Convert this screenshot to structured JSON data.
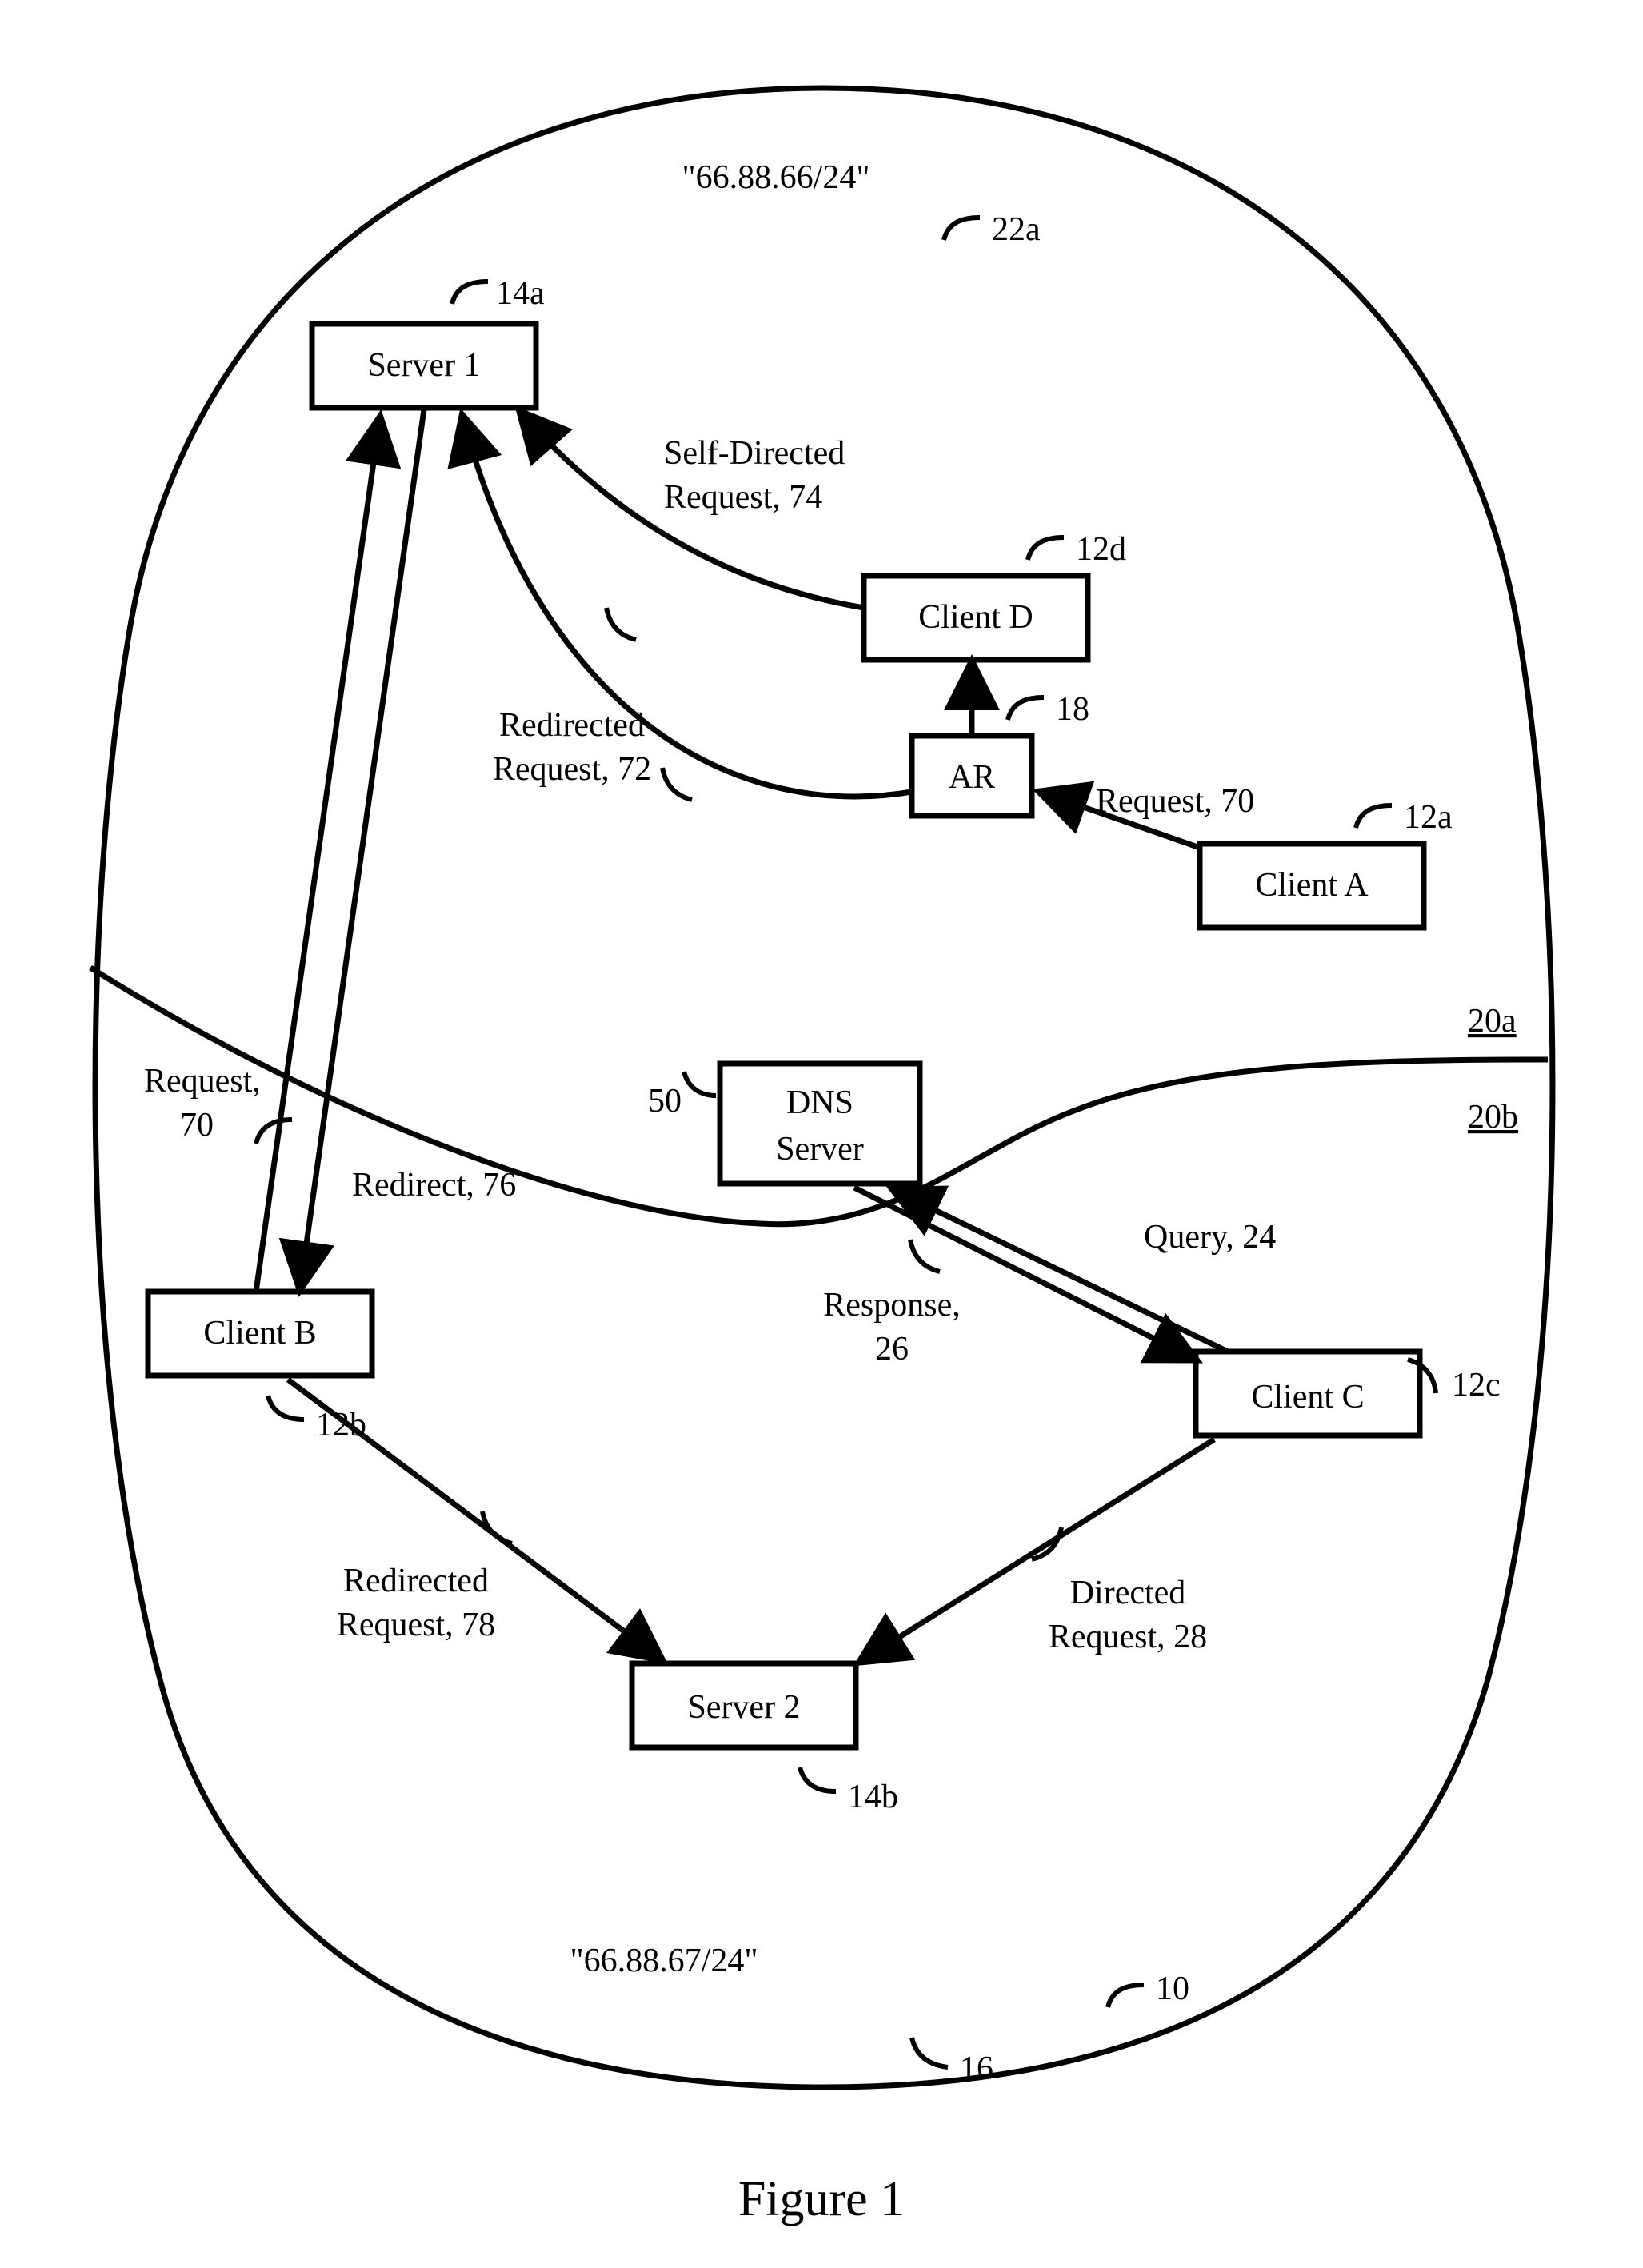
{
  "figure": {
    "title": "Figure 1",
    "networks": {
      "top": {
        "cidr": "\"66.88.66/24\"",
        "ref": "22a"
      },
      "bottom": {
        "cidr": "\"66.88.67/24\"",
        "refBoundary": "16",
        "refSystem": "10"
      },
      "regionTopRef": "20a",
      "regionBottomRef": "20b"
    },
    "nodes": {
      "server1": {
        "label": "Server 1",
        "ref": "14a"
      },
      "server2": {
        "label": "Server 2",
        "ref": "14b"
      },
      "dns": {
        "label1": "DNS",
        "label2": "Server",
        "ref": "50"
      },
      "ar": {
        "label": "AR",
        "ref": "18"
      },
      "clientA": {
        "label": "Client A",
        "ref": "12a"
      },
      "clientB": {
        "label": "Client B",
        "ref": "12b"
      },
      "clientC": {
        "label": "Client C",
        "ref": "12c"
      },
      "clientD": {
        "label": "Client D",
        "ref": "12d"
      }
    },
    "edges": {
      "request70a": {
        "label": "Request, 70"
      },
      "request70b": {
        "label1": "Request,",
        "label2": "70"
      },
      "redirected72": {
        "label1": "Redirected",
        "label2": "Request, 72"
      },
      "selfDirected74": {
        "label1": "Self-Directed",
        "label2": "Request, 74"
      },
      "redirect76": {
        "label": "Redirect, 76"
      },
      "redirected78": {
        "label1": "Redirected",
        "label2": "Request, 78"
      },
      "query24": {
        "label": "Query, 24"
      },
      "response26": {
        "label1": "Response,",
        "label2": "26"
      },
      "directed28": {
        "label1": "Directed",
        "label2": "Request, 28"
      }
    }
  }
}
